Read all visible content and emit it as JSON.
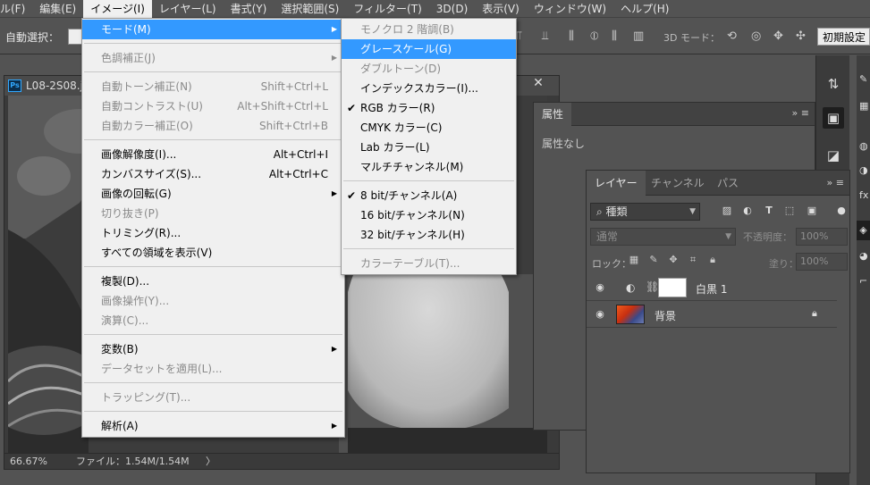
{
  "menubar": {
    "items": [
      "ル(F)",
      "編集(E)",
      "イメージ(I)",
      "レイヤー(L)",
      "書式(Y)",
      "選択範囲(S)",
      "フィルター(T)",
      "3D(D)",
      "表示(V)",
      "ウィンドウ(W)",
      "ヘルプ(H)"
    ]
  },
  "options": {
    "auto_select": "自動選択：",
    "mode3d": "3D モード：",
    "preset": "初期設定"
  },
  "document": {
    "title": "L08-2S08.jp",
    "logo": "Ps",
    "zoom": "66.67%",
    "file_info": "ファイル：1.54M/1.54M",
    "close": "✕"
  },
  "image_menu": {
    "mode": "モード(M)",
    "color_correct": "色調補正(J)",
    "auto_tone": "自動トーン補正(N)",
    "auto_tone_sc": "Shift+Ctrl+L",
    "auto_contrast": "自動コントラスト(U)",
    "auto_contrast_sc": "Alt+Shift+Ctrl+L",
    "auto_color": "自動カラー補正(O)",
    "auto_color_sc": "Shift+Ctrl+B",
    "image_size": "画像解像度(I)...",
    "image_size_sc": "Alt+Ctrl+I",
    "canvas_size": "カンバスサイズ(S)...",
    "canvas_size_sc": "Alt+Ctrl+C",
    "rotate": "画像の回転(G)",
    "crop": "切り抜き(P)",
    "trim": "トリミング(R)...",
    "reveal_all": "すべての領域を表示(V)",
    "duplicate": "複製(D)...",
    "apply_image": "画像操作(Y)...",
    "calculations": "演算(C)...",
    "variables": "変数(B)",
    "apply_dataset": "データセットを適用(L)...",
    "trap": "トラッピング(T)...",
    "analysis": "解析(A)"
  },
  "mode_menu": {
    "bitmap": "モノクロ 2 階調(B)",
    "grayscale": "グレースケール(G)",
    "duotone": "ダブルトーン(D)",
    "indexed": "インデックスカラー(I)...",
    "rgb": "RGB カラー(R)",
    "cmyk": "CMYK カラー(C)",
    "lab": "Lab カラー(L)",
    "multichannel": "マルチチャンネル(M)",
    "bit8": "8 bit/チャンネル(A)",
    "bit16": "16 bit/チャンネル(N)",
    "bit32": "32 bit/チャンネル(H)",
    "color_table": "カラーテーブル(T)...",
    "check": "✔"
  },
  "properties": {
    "tab": "属性",
    "body": "属性なし",
    "ctl": "»  ≡"
  },
  "layers": {
    "tabs": [
      "レイヤー",
      "チャンネル",
      "パス"
    ],
    "ctl": "»  ≡",
    "filter": "種類",
    "blend": "通常",
    "opacity_label": "不透明度：",
    "opacity": "100%",
    "lock_label": "ロック：",
    "fill_label": "塗り：",
    "fill": "100%",
    "layer1": "白黒 1",
    "layer2": "背景"
  },
  "colors": {
    "highlight": "#3399ff",
    "menu_bg": "#f0f0f0",
    "panel": "#535353"
  }
}
